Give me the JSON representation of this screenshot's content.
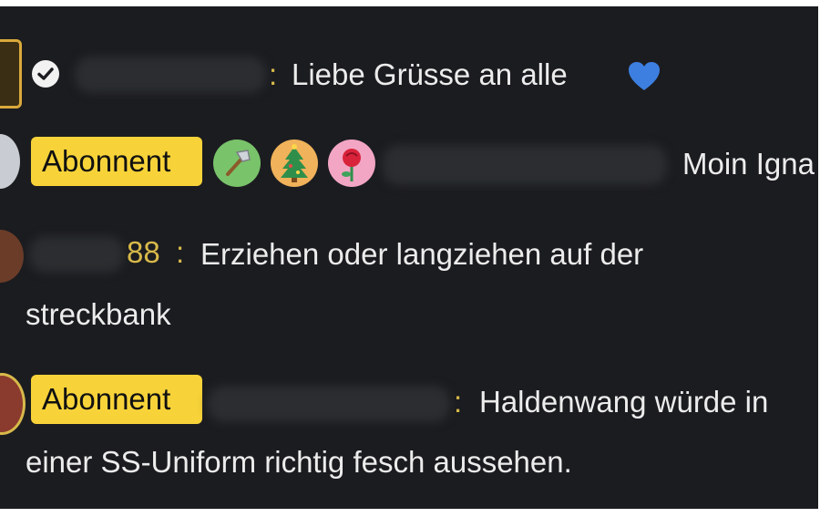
{
  "messages": [
    {
      "separator": ":",
      "text": "Liebe Grüsse an alle",
      "icons": [
        "verified-check-icon",
        "blue-heart-icon"
      ]
    },
    {
      "badge": "Abonnent",
      "icons": [
        "axe-icon",
        "christmas-tree-icon",
        "rose-icon"
      ],
      "text": "Moin Igna"
    },
    {
      "username_suffix": "88",
      "separator": ":",
      "text_line1": "Erziehen oder langziehen auf der",
      "text_line2": "streckbank"
    },
    {
      "badge": "Abonnent",
      "separator": ":",
      "text_line1": "Haldenwang würde in",
      "text_line2": "einer SS-Uniform richtig fesch aussehen."
    }
  ],
  "colors": {
    "background": "#1b1c20",
    "badge": "#f7d339",
    "username_accent": "#d8b94a",
    "heart": "#3d7fe0"
  }
}
